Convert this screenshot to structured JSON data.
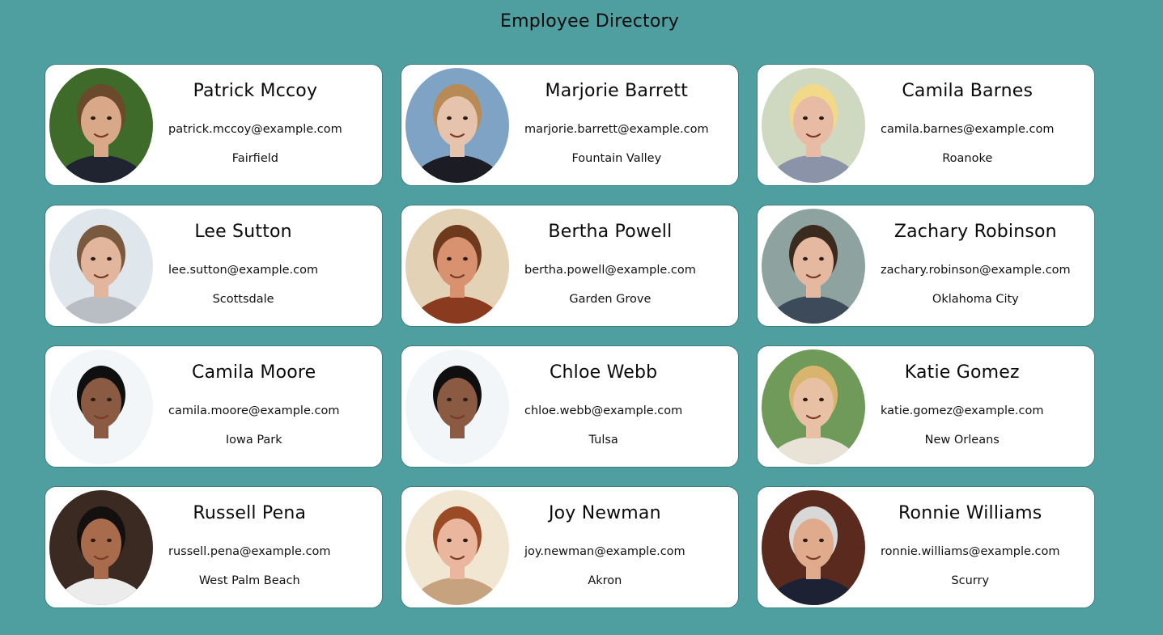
{
  "page": {
    "title": "Employee Directory"
  },
  "employees": [
    {
      "name": "Patrick Mccoy",
      "email": "patrick.mccoy@example.com",
      "city": "Fairfield",
      "bg": "#3f6b2a",
      "skin": "#d9a888",
      "hair": "#6b4a2c",
      "shirt": "#1f2430"
    },
    {
      "name": "Marjorie Barrett",
      "email": "marjorie.barrett@example.com",
      "city": "Fountain Valley",
      "bg": "#7fa3c4",
      "skin": "#e6c3ad",
      "hair": "#b88a56",
      "shirt": "#1c1c24"
    },
    {
      "name": "Camila Barnes",
      "email": "camila.barnes@example.com",
      "city": "Roanoke",
      "bg": "#cfd8c0",
      "skin": "#e8bca4",
      "hair": "#f2d98a",
      "shirt": "#8a93a8"
    },
    {
      "name": "Lee Sutton",
      "email": "lee.sutton@example.com",
      "city": "Scottsdale",
      "bg": "#dfe6ec",
      "skin": "#e2b69c",
      "hair": "#7a5a3e",
      "shirt": "#b9bec4"
    },
    {
      "name": "Bertha Powell",
      "email": "bertha.powell@example.com",
      "city": "Garden Grove",
      "bg": "#e4d2b6",
      "skin": "#d89270",
      "hair": "#6e3a1e",
      "shirt": "#8a3b1f"
    },
    {
      "name": "Zachary Robinson",
      "email": "zachary.robinson@example.com",
      "city": "Oklahoma City",
      "bg": "#8ea3a0",
      "skin": "#e5b8a0",
      "hair": "#3b2a1e",
      "shirt": "#3d4a5a"
    },
    {
      "name": "Camila Moore",
      "email": "camila.moore@example.com",
      "city": "Iowa Park",
      "bg": "#f3f6f8",
      "skin": "#8a5a42",
      "hair": "#0f0f0f",
      "shirt": "#f3f6f8"
    },
    {
      "name": "Chloe Webb",
      "email": "chloe.webb@example.com",
      "city": "Tulsa",
      "bg": "#f3f6f8",
      "skin": "#8a5a42",
      "hair": "#0f0f0f",
      "shirt": "#f3f6f8"
    },
    {
      "name": "Katie Gomez",
      "email": "katie.gomez@example.com",
      "city": "New Orleans",
      "bg": "#6f9a5a",
      "skin": "#e8c0a4",
      "hair": "#d8b46e",
      "shirt": "#e9e2d6"
    },
    {
      "name": "Russell Pena",
      "email": "russell.pena@example.com",
      "city": "West Palm Beach",
      "bg": "#3a2a22",
      "skin": "#a86c4c",
      "hair": "#141010",
      "shirt": "#ececec"
    },
    {
      "name": "Joy Newman",
      "email": "joy.newman@example.com",
      "city": "Akron",
      "bg": "#f1e6d2",
      "skin": "#eab79e",
      "hair": "#9a4a24",
      "shirt": "#c7a27e"
    },
    {
      "name": "Ronnie Williams",
      "email": "ronnie.williams@example.com",
      "city": "Scurry",
      "bg": "#5a2a1e",
      "skin": "#e0aa8c",
      "hair": "#d8d8d8",
      "shirt": "#1c2233"
    }
  ]
}
